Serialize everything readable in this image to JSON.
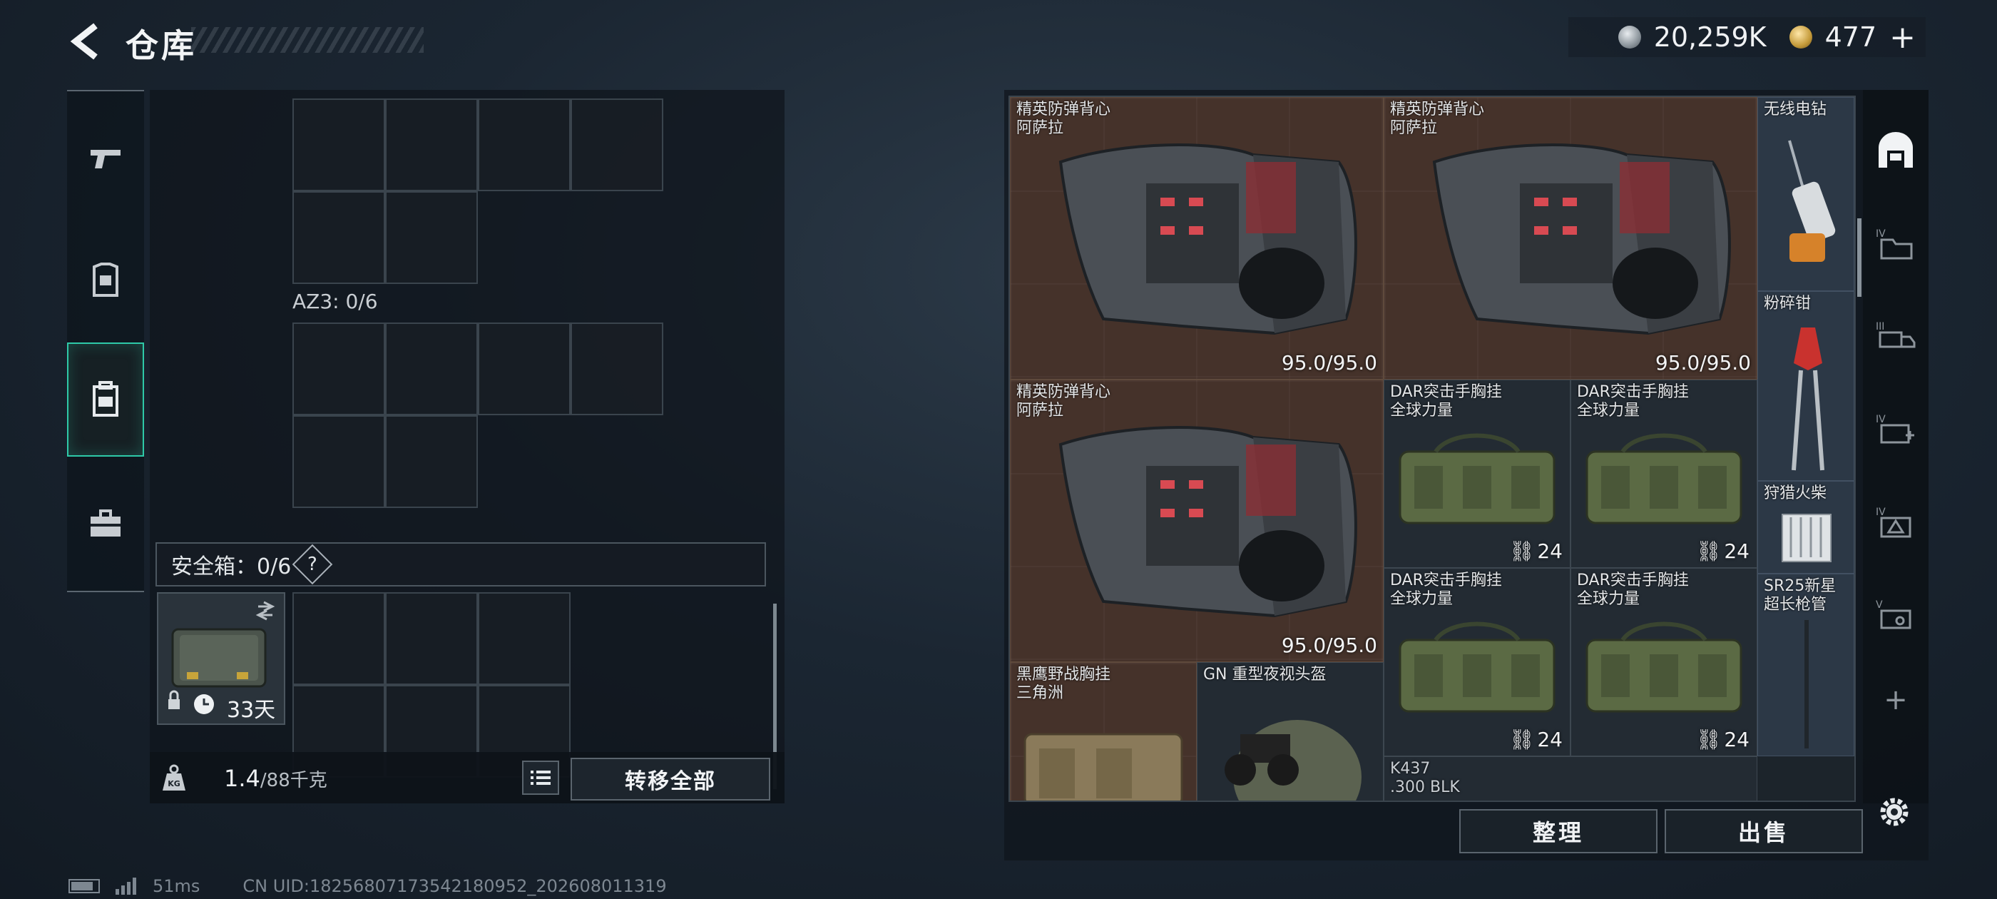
{
  "header": {
    "title": "仓库",
    "currency_silver": "20,259K",
    "currency_gold": "477",
    "add_label": "+"
  },
  "left": {
    "az3_label": "AZ3: 0/6",
    "safebox_label": "安全箱：0/6",
    "safebox_help": "?",
    "safebox_timer": "33天",
    "weight_current": "1.4",
    "weight_max": "/88千克",
    "kg_label": "KG",
    "transfer_all": "转移全部"
  },
  "right": {
    "items": [
      {
        "name1": "精英防弹背心",
        "name2": "阿萨拉",
        "durability": "95.0/95.0"
      },
      {
        "name1": "精英防弹背心",
        "name2": "阿萨拉",
        "durability": "95.0/95.0"
      },
      {
        "name1": "精英防弹背心",
        "name2": "阿萨拉",
        "durability": "95.0/95.0"
      },
      {
        "name1": "DAR突击手胸挂",
        "name2": "全球力量",
        "count": "24"
      },
      {
        "name1": "DAR突击手胸挂",
        "name2": "全球力量",
        "count": "24"
      },
      {
        "name1": "DAR突击手胸挂",
        "name2": "全球力量",
        "count": "24"
      },
      {
        "name1": "DAR突击手胸挂",
        "name2": "全球力量",
        "count": "24"
      },
      {
        "name1": "黑鹰野战胸挂",
        "name2": "三角洲"
      },
      {
        "name1": "GN 重型夜视头盔"
      },
      {
        "name1": "K437",
        "name2": ".300 BLK"
      },
      {
        "name1": "无线电钻"
      },
      {
        "name1": "粉碎钳"
      },
      {
        "name1": "狩猎火柴"
      },
      {
        "name1": "SR25新星",
        "name2": "超长枪管"
      }
    ],
    "sort_label": "整理",
    "sell_label": "出售",
    "side_add": "+"
  },
  "status": {
    "ping": "51ms",
    "uid": "CN UID:18256807173542180952_202608011319"
  },
  "colors": {
    "accent": "#2ec9a8",
    "item_brown": "#45322a",
    "item_slate": "#2c3846"
  }
}
